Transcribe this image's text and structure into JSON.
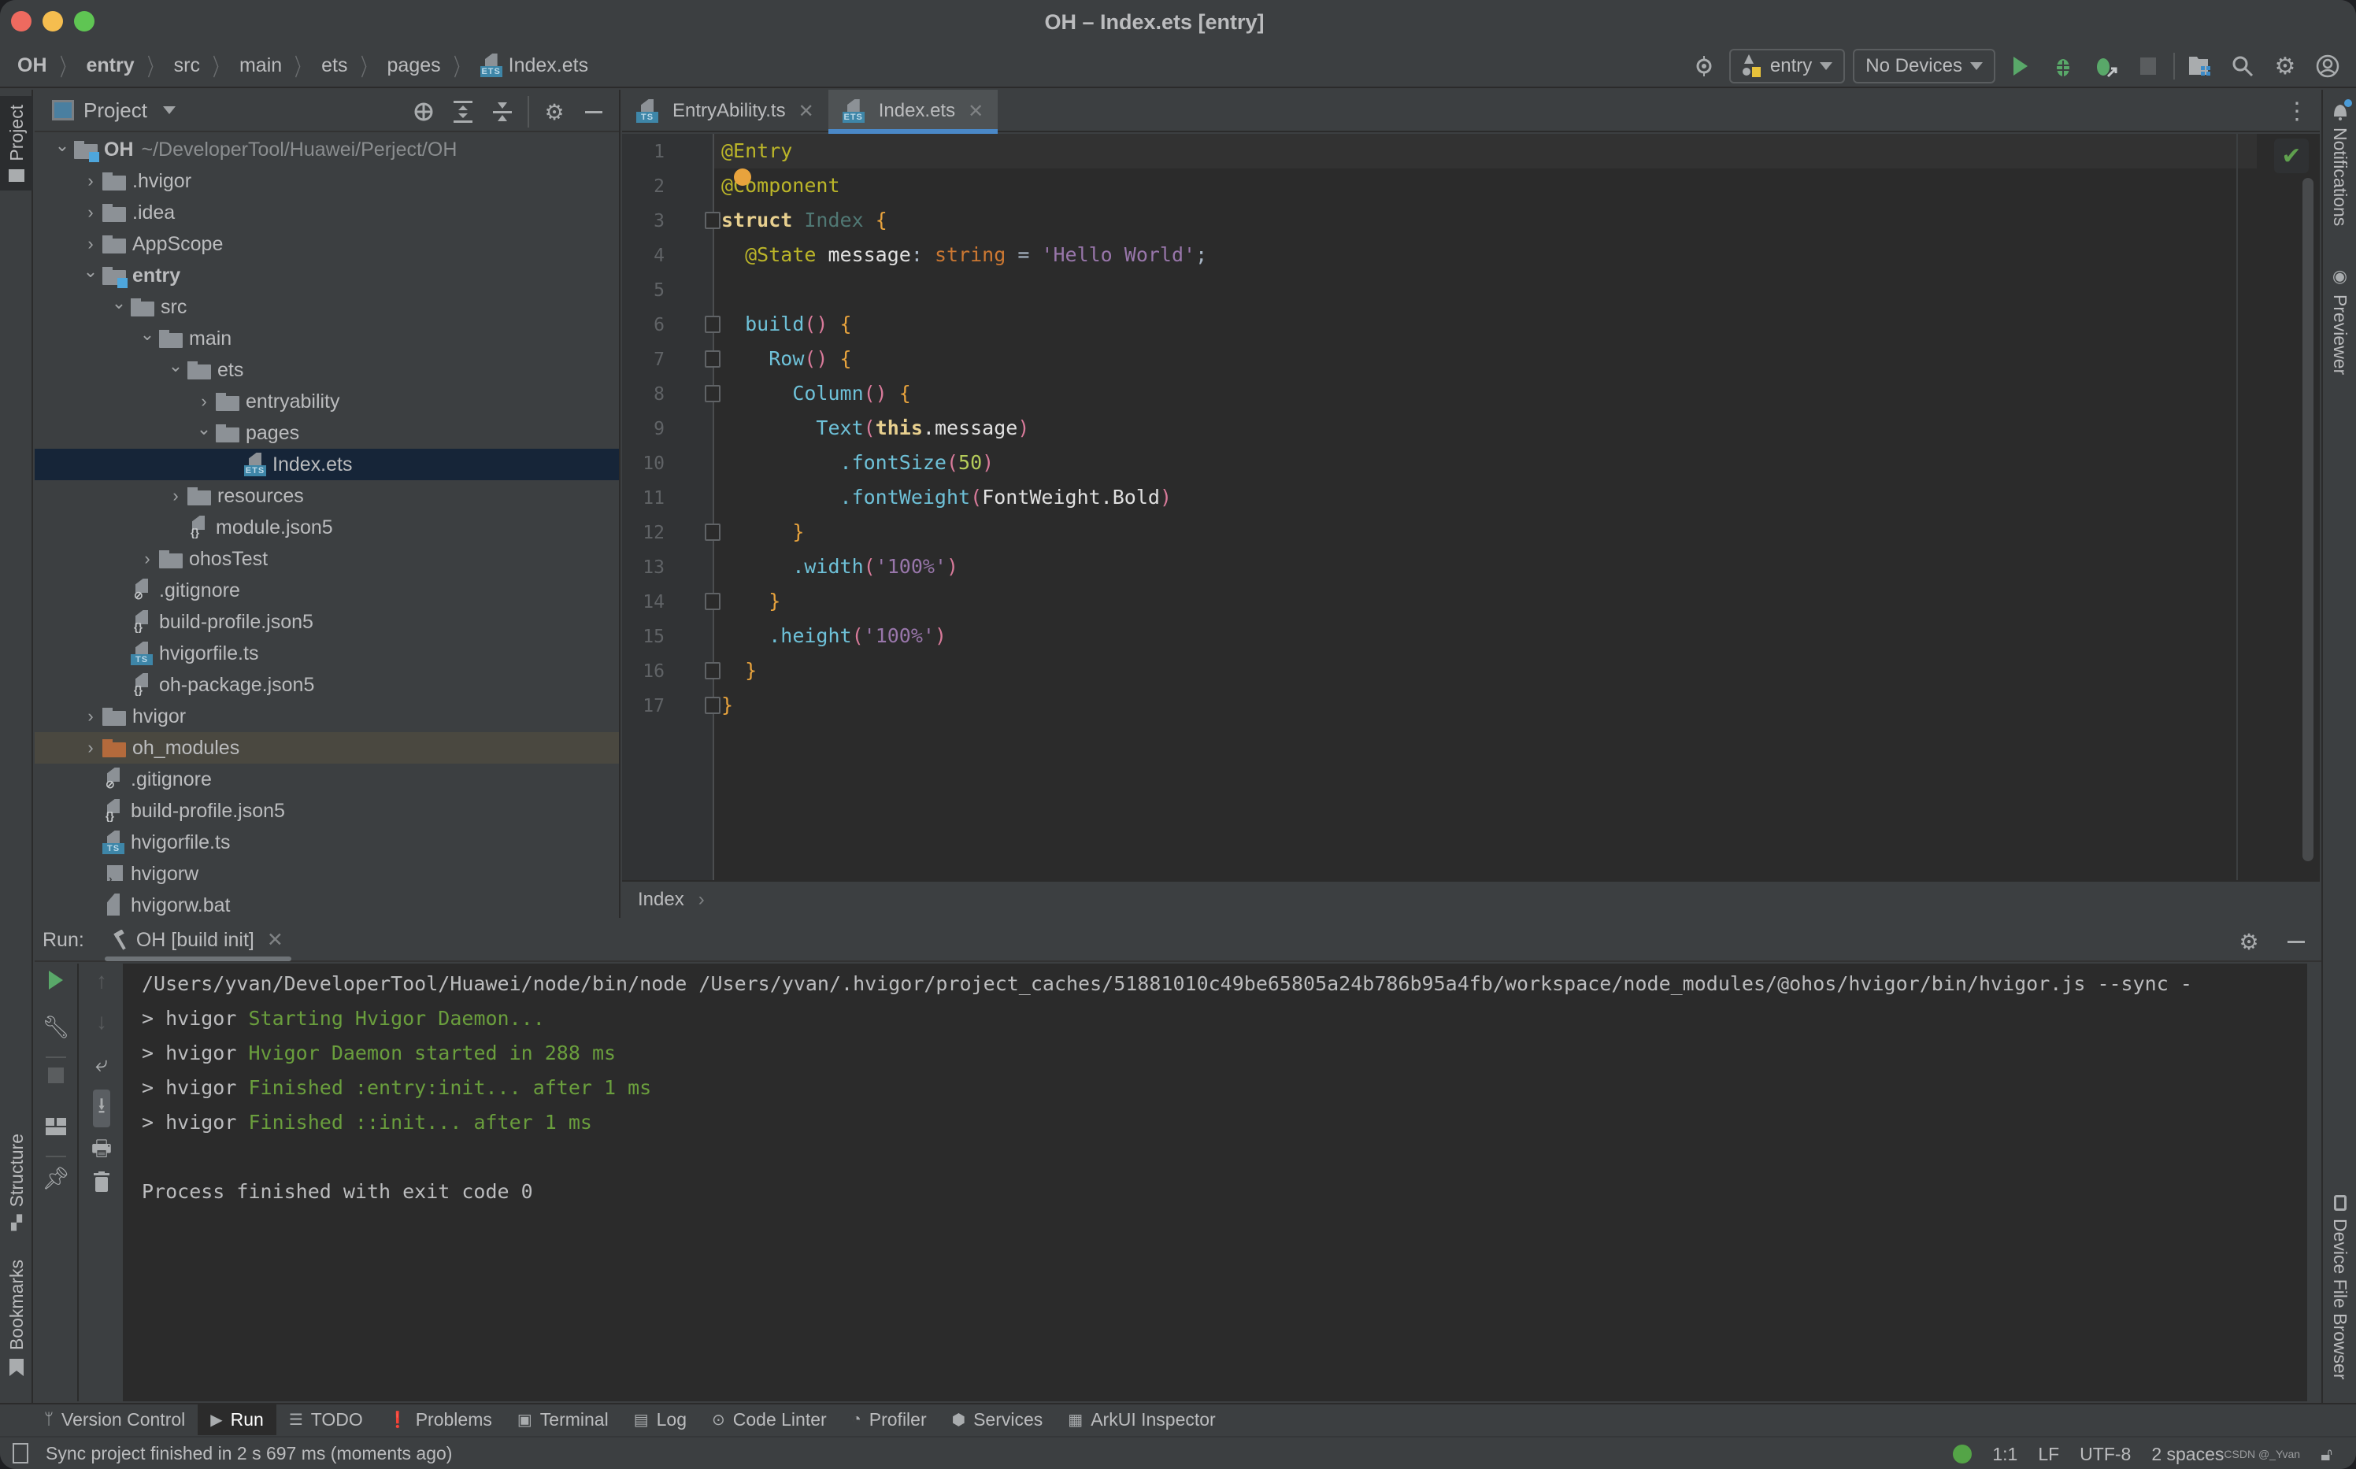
{
  "window": {
    "title": "OH – Index.ets [entry]"
  },
  "breadcrumb": [
    "OH",
    "entry",
    "src",
    "main",
    "ets",
    "pages",
    "Index.ets"
  ],
  "toolbar": {
    "module_selector": "entry",
    "device_selector": "No Devices"
  },
  "side_tabs": {
    "left_top": "Project",
    "left_bottom": [
      "Structure",
      "Bookmarks"
    ],
    "right": [
      "Notifications",
      "Previewer",
      "Device File Browser"
    ]
  },
  "project_panel": {
    "title": "Project",
    "root_path": "~/DeveloperTool/Huawei/Perject/OH",
    "tree": [
      {
        "label": "OH",
        "depth": 0,
        "type": "module-folder",
        "expanded": true,
        "bold": true
      },
      {
        "label": ".hvigor",
        "depth": 1,
        "type": "folder",
        "expanded": false
      },
      {
        "label": ".idea",
        "depth": 1,
        "type": "folder",
        "expanded": false
      },
      {
        "label": "AppScope",
        "depth": 1,
        "type": "folder",
        "expanded": false
      },
      {
        "label": "entry",
        "depth": 1,
        "type": "module-folder",
        "expanded": true,
        "bold": true
      },
      {
        "label": "src",
        "depth": 2,
        "type": "folder",
        "expanded": true
      },
      {
        "label": "main",
        "depth": 3,
        "type": "folder",
        "expanded": true
      },
      {
        "label": "ets",
        "depth": 4,
        "type": "folder",
        "expanded": true
      },
      {
        "label": "entryability",
        "depth": 5,
        "type": "folder",
        "expanded": false
      },
      {
        "label": "pages",
        "depth": 5,
        "type": "folder",
        "expanded": true
      },
      {
        "label": "Index.ets",
        "depth": 6,
        "type": "ets",
        "selected": true
      },
      {
        "label": "resources",
        "depth": 4,
        "type": "folder",
        "expanded": false
      },
      {
        "label": "module.json5",
        "depth": 4,
        "type": "json"
      },
      {
        "label": "ohosTest",
        "depth": 3,
        "type": "folder",
        "expanded": false
      },
      {
        "label": ".gitignore",
        "depth": 2,
        "type": "ignore"
      },
      {
        "label": "build-profile.json5",
        "depth": 2,
        "type": "json"
      },
      {
        "label": "hvigorfile.ts",
        "depth": 2,
        "type": "ts"
      },
      {
        "label": "oh-package.json5",
        "depth": 2,
        "type": "json"
      },
      {
        "label": "hvigor",
        "depth": 1,
        "type": "folder",
        "expanded": false
      },
      {
        "label": "oh_modules",
        "depth": 1,
        "type": "excluded-folder",
        "expanded": false
      },
      {
        "label": ".gitignore",
        "depth": 1,
        "type": "ignore"
      },
      {
        "label": "build-profile.json5",
        "depth": 1,
        "type": "json"
      },
      {
        "label": "hvigorfile.ts",
        "depth": 1,
        "type": "ts"
      },
      {
        "label": "hvigorw",
        "depth": 1,
        "type": "shell"
      },
      {
        "label": "hvigorw.bat",
        "depth": 1,
        "type": "text"
      }
    ]
  },
  "editor": {
    "tabs": [
      {
        "label": "EntryAbility.ts",
        "type": "ts",
        "active": false
      },
      {
        "label": "Index.ets",
        "type": "ets",
        "active": true
      }
    ],
    "lines": [
      [
        [
          "@Entry",
          "k-ann"
        ]
      ],
      [
        [
          "@Component",
          "k-ann"
        ]
      ],
      [
        [
          "struct",
          "k-struct"
        ],
        [
          " ",
          ""
        ],
        [
          "Index",
          "k-cls"
        ],
        [
          " ",
          ""
        ],
        [
          "{",
          "k-brace"
        ]
      ],
      [
        [
          "  ",
          ""
        ],
        [
          "@State",
          "k-ann"
        ],
        [
          " message",
          "k-white"
        ],
        [
          ": ",
          ""
        ],
        [
          "string",
          "k-type"
        ],
        [
          " = ",
          ""
        ],
        [
          "'Hello World'",
          "k-str"
        ],
        [
          ";",
          ""
        ]
      ],
      [],
      [
        [
          "  ",
          ""
        ],
        [
          "build",
          "k-fn"
        ],
        [
          "()",
          "k-paren"
        ],
        [
          " ",
          ""
        ],
        [
          "{",
          "k-brace"
        ]
      ],
      [
        [
          "    ",
          ""
        ],
        [
          "Row",
          "k-fn"
        ],
        [
          "()",
          "k-paren"
        ],
        [
          " ",
          ""
        ],
        [
          "{",
          "k-brace"
        ]
      ],
      [
        [
          "      ",
          ""
        ],
        [
          "Column",
          "k-fn"
        ],
        [
          "()",
          "k-paren"
        ],
        [
          " ",
          ""
        ],
        [
          "{",
          "k-brace"
        ]
      ],
      [
        [
          "        ",
          ""
        ],
        [
          "Text",
          "k-fn"
        ],
        [
          "(",
          "k-paren"
        ],
        [
          "this",
          "k-this"
        ],
        [
          ".message",
          "k-white"
        ],
        [
          ")",
          "k-paren"
        ]
      ],
      [
        [
          "          ",
          ""
        ],
        [
          ".fontSize",
          "k-fn"
        ],
        [
          "(",
          "k-paren"
        ],
        [
          "50",
          "k-num"
        ],
        [
          ")",
          "k-paren"
        ]
      ],
      [
        [
          "          ",
          ""
        ],
        [
          ".fontWeight",
          "k-fn"
        ],
        [
          "(",
          "k-paren"
        ],
        [
          "FontWeight.Bold",
          "k-white"
        ],
        [
          ")",
          "k-paren"
        ]
      ],
      [
        [
          "      ",
          ""
        ],
        [
          "}",
          "k-brace"
        ]
      ],
      [
        [
          "      ",
          ""
        ],
        [
          ".width",
          "k-fn"
        ],
        [
          "(",
          "k-paren"
        ],
        [
          "'100%'",
          "k-str"
        ],
        [
          ")",
          "k-paren"
        ]
      ],
      [
        [
          "    ",
          ""
        ],
        [
          "}",
          "k-brace"
        ]
      ],
      [
        [
          "    ",
          ""
        ],
        [
          ".height",
          "k-fn"
        ],
        [
          "(",
          "k-paren"
        ],
        [
          "'100%'",
          "k-str"
        ],
        [
          ")",
          "k-paren"
        ]
      ],
      [
        [
          "  ",
          ""
        ],
        [
          "}",
          "k-brace"
        ]
      ],
      [
        [
          "}",
          "k-brace"
        ]
      ]
    ],
    "breadcrumb": "Index",
    "inspection_status": "no-problems"
  },
  "run_panel": {
    "label": "Run:",
    "tab_label": "OH [build init]",
    "output": [
      [
        {
          "t": "/Users/yvan/DeveloperTool/Huawei/node/bin/node /Users/yvan/.hvigor/project_caches/51881010c49be65805a24b786b95a4fb/workspace/node_modules/@ohos/hvigor/bin/hvigor.js --sync -",
          "c": ""
        }
      ],
      [
        {
          "t": "> hvigor ",
          "c": ""
        },
        {
          "t": "Starting Hvigor Daemon...",
          "c": "green"
        }
      ],
      [
        {
          "t": "> hvigor ",
          "c": ""
        },
        {
          "t": "Hvigor Daemon started in 288 ms",
          "c": "green"
        }
      ],
      [
        {
          "t": "> hvigor ",
          "c": ""
        },
        {
          "t": "Finished :entry:init... after 1 ms",
          "c": "green"
        }
      ],
      [
        {
          "t": "> hvigor ",
          "c": ""
        },
        {
          "t": "Finished ::init... after 1 ms",
          "c": "green"
        }
      ],
      [],
      [
        {
          "t": "Process finished with exit code 0",
          "c": ""
        }
      ]
    ]
  },
  "tool_windows": [
    {
      "label": "Version Control",
      "icon": "branch-icon",
      "active": false
    },
    {
      "label": "Run",
      "icon": "play-icon",
      "active": true
    },
    {
      "label": "TODO",
      "icon": "list-icon",
      "active": false
    },
    {
      "label": "Problems",
      "icon": "warning-icon",
      "active": false
    },
    {
      "label": "Terminal",
      "icon": "terminal-icon",
      "active": false
    },
    {
      "label": "Log",
      "icon": "log-icon",
      "active": false
    },
    {
      "label": "Code Linter",
      "icon": "linter-icon",
      "active": false
    },
    {
      "label": "Profiler",
      "icon": "profiler-icon",
      "active": false
    },
    {
      "label": "Services",
      "icon": "services-icon",
      "active": false
    },
    {
      "label": "ArkUI Inspector",
      "icon": "inspector-icon",
      "active": false
    }
  ],
  "status_bar": {
    "message": "Sync project finished in 2 s 697 ms (moments ago)",
    "position": "1:1",
    "line_separator": "LF",
    "encoding": "UTF-8",
    "indent": "2 spaces",
    "watermark": "CSDN @_Yvan"
  }
}
